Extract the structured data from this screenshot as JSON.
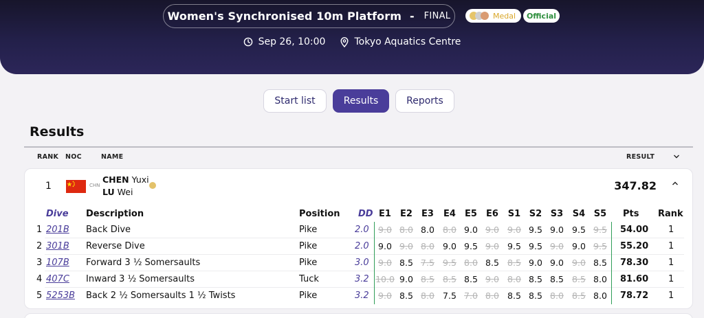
{
  "header": {
    "event_title": "Women's Synchronised 10m Platform",
    "separator": "-",
    "phase": "FINAL",
    "medal_badge": "Medal",
    "official_badge": "Official",
    "datetime": "Sep 26, 10:00",
    "venue": "Tokyo Aquatics Centre",
    "icons": [
      "clock-icon",
      "location-pin-icon"
    ]
  },
  "tabs": [
    {
      "label": "Start list",
      "active": false
    },
    {
      "label": "Results",
      "active": true
    },
    {
      "label": "Reports",
      "active": false
    }
  ],
  "section_title": "Results",
  "columns": {
    "rank": "RANK",
    "noc": "NOC",
    "name": "NAME",
    "result": "RESULT"
  },
  "entry": {
    "rank": "1",
    "noc": "CHN",
    "athlete1_surname": "CHEN",
    "athlete1_given": "Yuxi",
    "athlete2_surname": "LU",
    "athlete2_given": "Wei",
    "medal": "gold",
    "result": "347.82"
  },
  "dive_table": {
    "headers": {
      "dive": "Dive",
      "description": "Description",
      "position": "Position",
      "dd": "DD",
      "scores": [
        "E1",
        "E2",
        "E3",
        "E4",
        "E5",
        "E6",
        "S1",
        "S2",
        "S3",
        "S4",
        "S5"
      ],
      "pts": "Pts",
      "rank": "Rank"
    },
    "rows": [
      {
        "n": "1",
        "code": "201B",
        "description": "Back Dive",
        "position": "Pike",
        "dd": "2.0",
        "scores": [
          {
            "v": "9.0",
            "x": true
          },
          {
            "v": "8.0",
            "x": true
          },
          {
            "v": "8.0",
            "x": false
          },
          {
            "v": "8.0",
            "x": true
          },
          {
            "v": "9.0",
            "x": false
          },
          {
            "v": "9.0",
            "x": true
          },
          {
            "v": "9.0",
            "x": true
          },
          {
            "v": "9.5",
            "x": false
          },
          {
            "v": "9.0",
            "x": false
          },
          {
            "v": "9.5",
            "x": false
          },
          {
            "v": "9.5",
            "x": true
          }
        ],
        "pts": "54.00",
        "rank": "1"
      },
      {
        "n": "2",
        "code": "301B",
        "description": "Reverse Dive",
        "position": "Pike",
        "dd": "2.0",
        "scores": [
          {
            "v": "9.0",
            "x": false
          },
          {
            "v": "9.0",
            "x": true
          },
          {
            "v": "8.0",
            "x": true
          },
          {
            "v": "9.0",
            "x": false
          },
          {
            "v": "9.5",
            "x": false
          },
          {
            "v": "9.0",
            "x": true
          },
          {
            "v": "9.5",
            "x": false
          },
          {
            "v": "9.5",
            "x": false
          },
          {
            "v": "9.0",
            "x": true
          },
          {
            "v": "9.0",
            "x": false
          },
          {
            "v": "9.5",
            "x": true
          }
        ],
        "pts": "55.20",
        "rank": "1"
      },
      {
        "n": "3",
        "code": "107B",
        "description": "Forward 3 ½ Somersaults",
        "position": "Pike",
        "dd": "3.0",
        "scores": [
          {
            "v": "9.0",
            "x": true
          },
          {
            "v": "8.5",
            "x": false
          },
          {
            "v": "7.5",
            "x": true
          },
          {
            "v": "9.5",
            "x": true
          },
          {
            "v": "8.0",
            "x": true
          },
          {
            "v": "8.5",
            "x": false
          },
          {
            "v": "8.5",
            "x": true
          },
          {
            "v": "9.0",
            "x": false
          },
          {
            "v": "9.0",
            "x": false
          },
          {
            "v": "9.0",
            "x": true
          },
          {
            "v": "8.5",
            "x": false
          }
        ],
        "pts": "78.30",
        "rank": "1"
      },
      {
        "n": "4",
        "code": "407C",
        "description": "Inward 3 ½ Somersaults",
        "position": "Tuck",
        "dd": "3.2",
        "scores": [
          {
            "v": "10.0",
            "x": true
          },
          {
            "v": "9.0",
            "x": false
          },
          {
            "v": "8.5",
            "x": true
          },
          {
            "v": "8.5",
            "x": true
          },
          {
            "v": "8.5",
            "x": false
          },
          {
            "v": "9.0",
            "x": true
          },
          {
            "v": "8.0",
            "x": true
          },
          {
            "v": "8.5",
            "x": false
          },
          {
            "v": "8.5",
            "x": false
          },
          {
            "v": "8.5",
            "x": true
          },
          {
            "v": "8.0",
            "x": false
          }
        ],
        "pts": "81.60",
        "rank": "1"
      },
      {
        "n": "5",
        "code": "5253B",
        "description": "Back 2 ½ Somersaults 1 ½ Twists",
        "position": "Pike",
        "dd": "3.2",
        "scores": [
          {
            "v": "9.0",
            "x": true
          },
          {
            "v": "8.5",
            "x": false
          },
          {
            "v": "8.0",
            "x": true
          },
          {
            "v": "7.5",
            "x": false
          },
          {
            "v": "7.0",
            "x": true
          },
          {
            "v": "8.0",
            "x": true
          },
          {
            "v": "8.5",
            "x": false
          },
          {
            "v": "8.5",
            "x": false
          },
          {
            "v": "8.0",
            "x": true
          },
          {
            "v": "8.5",
            "x": true
          },
          {
            "v": "8.0",
            "x": false
          }
        ],
        "pts": "78.72",
        "rank": "1"
      }
    ]
  },
  "colors": {
    "header_bg": "#23204a",
    "accent": "#4a3d9a",
    "gold": "#e3c26a",
    "official": "#2f8f3e",
    "divider_green": "#2f9d57"
  }
}
